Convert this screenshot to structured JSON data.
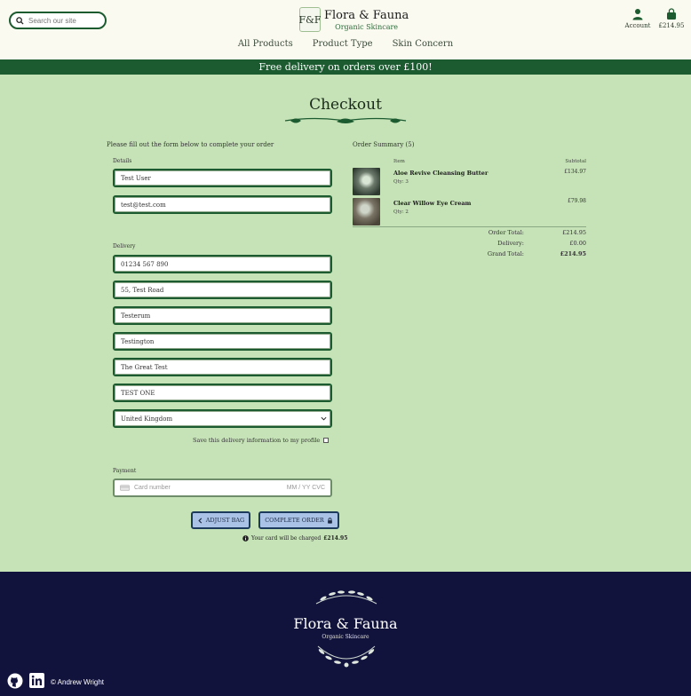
{
  "header": {
    "search_placeholder": "Search our site",
    "logo_mark": "F&F",
    "logo_title": "Flora & Fauna",
    "logo_subtitle": "Organic Skincare",
    "nav": [
      "All Products",
      "Product Type",
      "Skin Concern"
    ],
    "account_label": "Account",
    "bag_total": "£214.95"
  },
  "banner": "Free delivery on orders over £100!",
  "page_title": "Checkout",
  "form": {
    "instructions": "Please fill out the form below to complete your order",
    "details_label": "Details",
    "full_name": "Test User",
    "email": "test@test.com",
    "delivery_label": "Delivery",
    "phone": "01234 567 890",
    "street1": "55, Test Road",
    "town": "Testerum",
    "county": "Testington",
    "street2": "The Great Test",
    "postcode": "TEST ONE",
    "country": "United Kingdom",
    "save_info_label": "Save this delivery information to my profile",
    "payment_label": "Payment",
    "card_placeholder": "Card number",
    "card_expiry_cvc": "MM / YY  CVC",
    "adjust_bag_label": "ADJUST BAG",
    "complete_order_label": "COMPLETE ORDER",
    "charged_prefix": "Your card will be charged",
    "charged_amount": "£214.95"
  },
  "summary": {
    "title": "Order Summary (5)",
    "item_header": "Item",
    "subtotal_header": "Subtotal",
    "items": [
      {
        "name": "Aloe Revive Cleansing Butter",
        "qty": "Qty: 3",
        "price": "£134.97"
      },
      {
        "name": "Clear Willow Eye Cream",
        "qty": "Qty: 2",
        "price": "£79.98"
      }
    ],
    "order_total_label": "Order Total:",
    "order_total": "£214.95",
    "delivery_label": "Delivery:",
    "delivery": "£0.00",
    "grand_total_label": "Grand Total:",
    "grand_total": "£214.95"
  },
  "footer": {
    "title": "Flora & Fauna",
    "subtitle": "Organic Skincare",
    "copyright": "© Andrew Wright"
  },
  "colors": {
    "brand_green": "#1c5a30",
    "page_bg": "#c5e3b6",
    "footer_bg": "#12133d",
    "button_bg": "#a9c2e6"
  }
}
